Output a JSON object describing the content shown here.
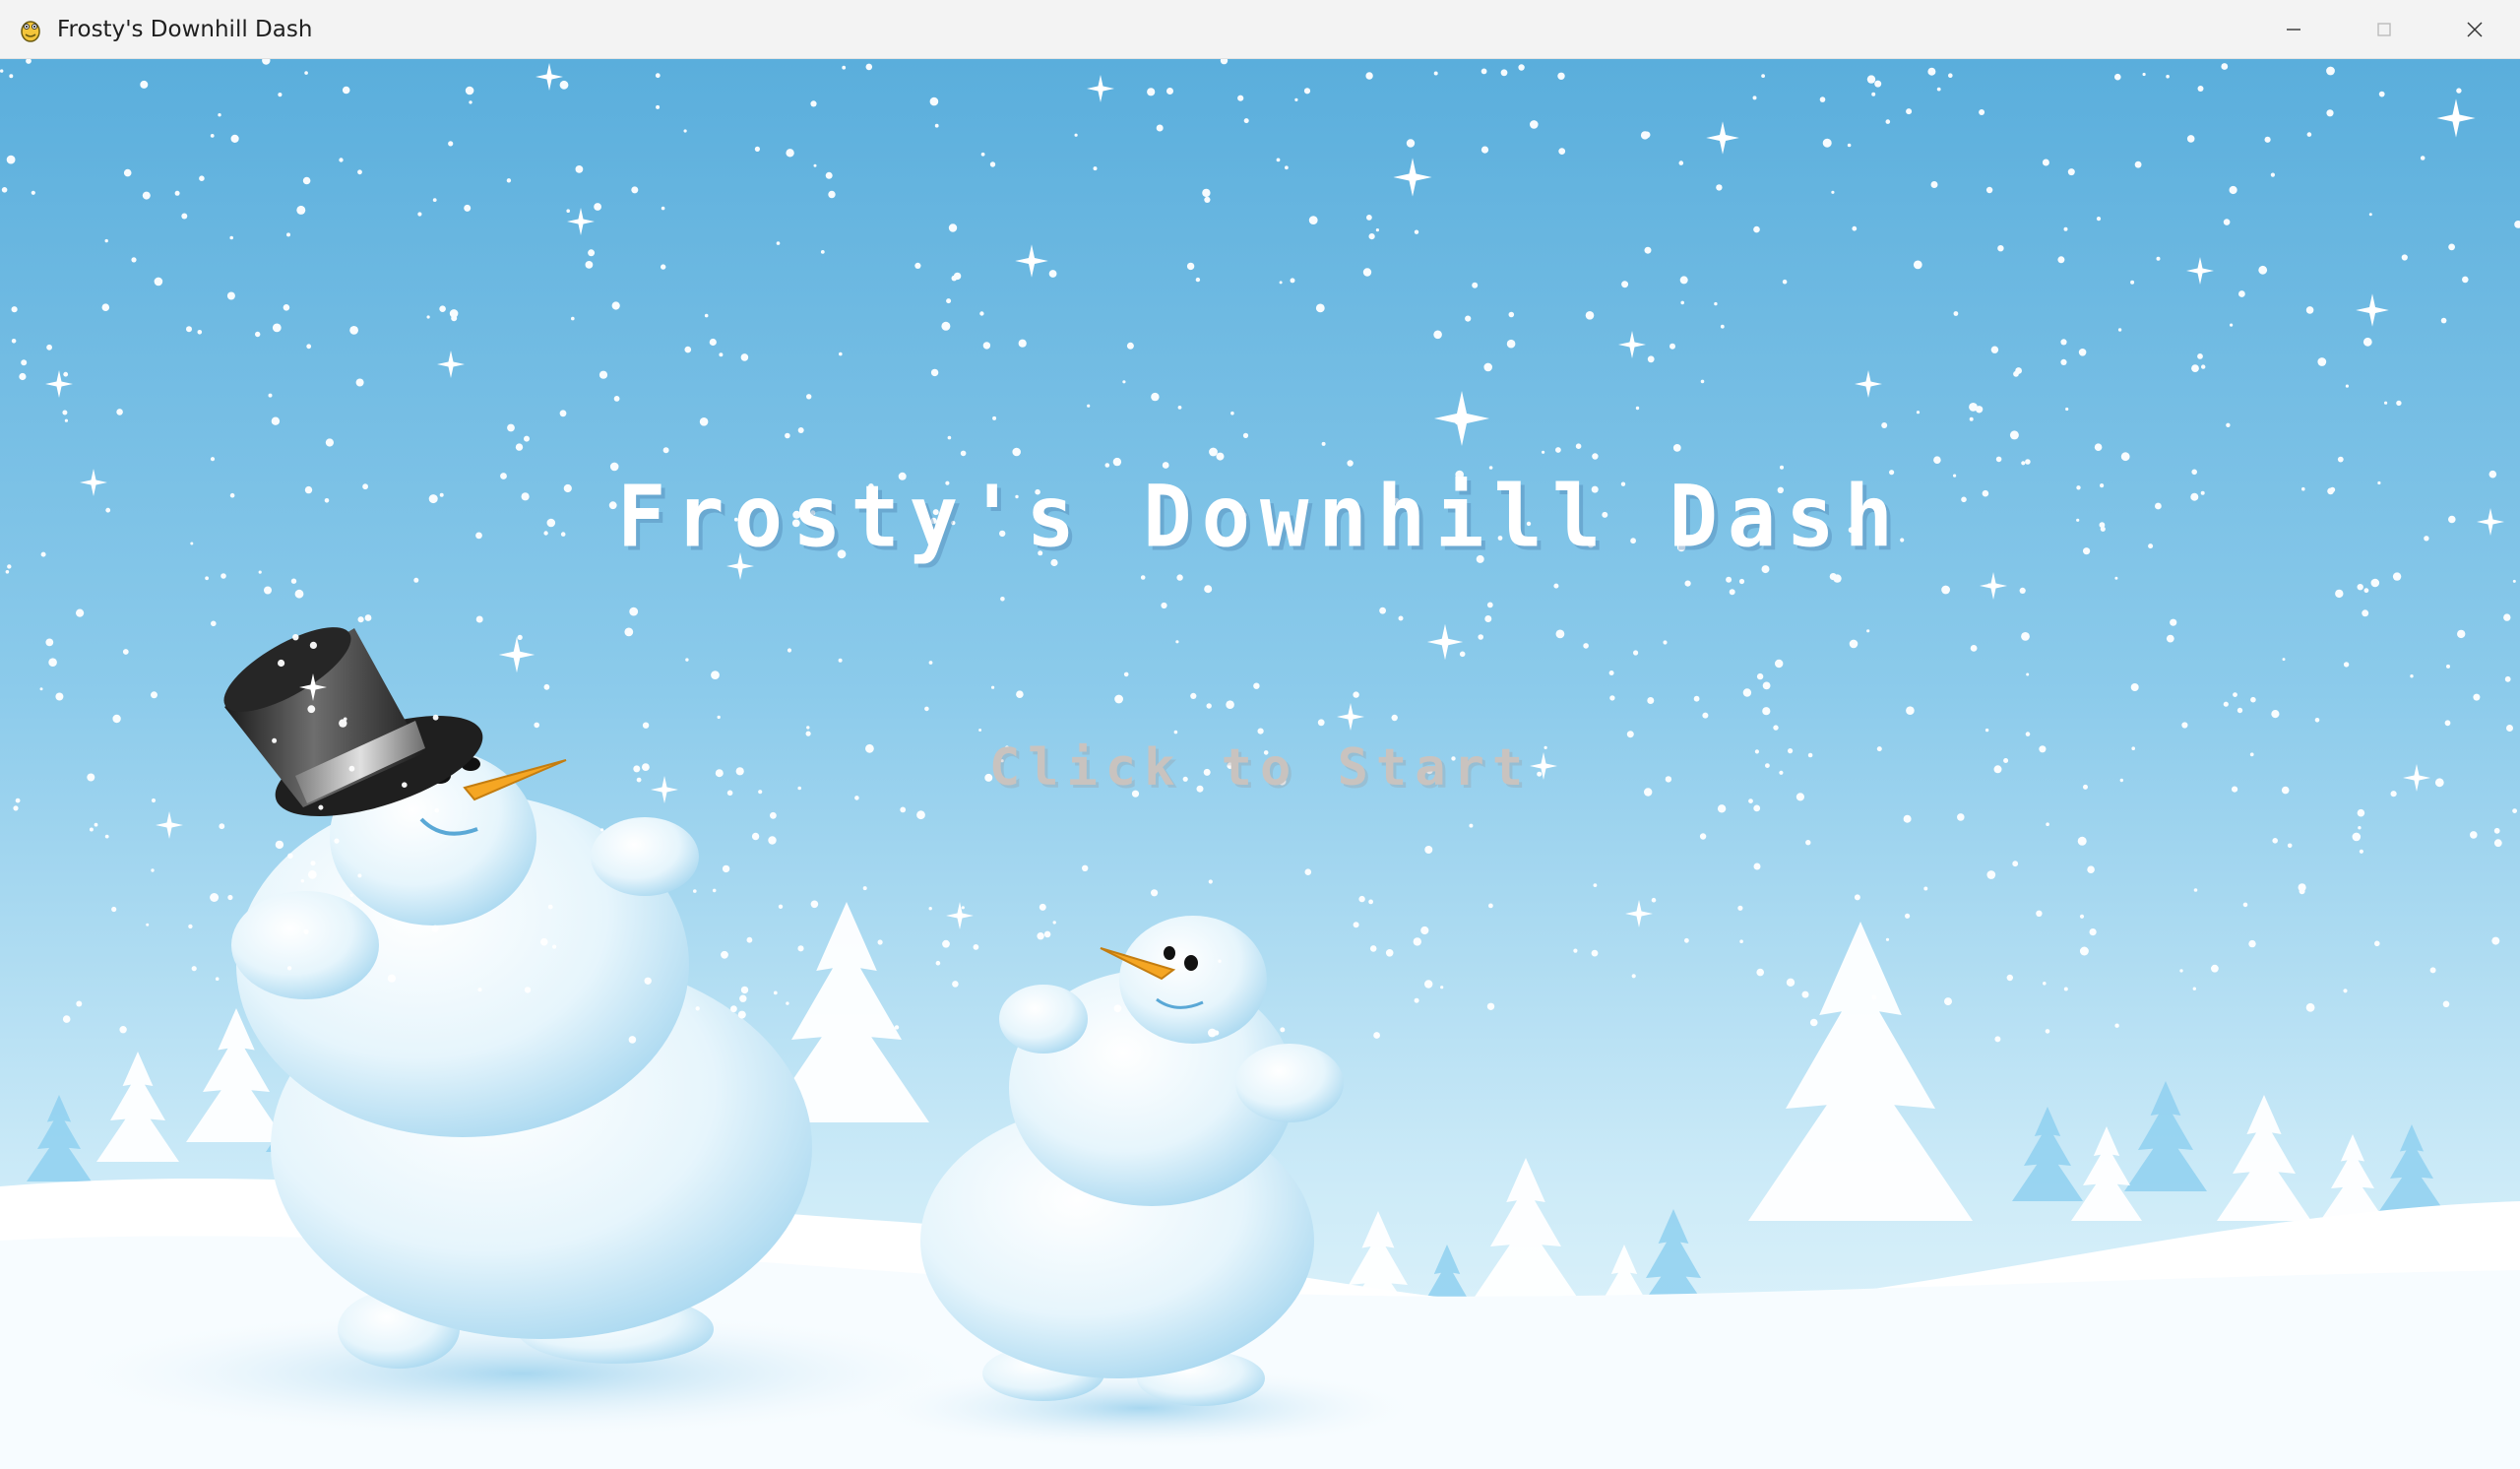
{
  "window": {
    "title": "Frosty's Downhill Dash",
    "app_icon": "pygame-snake-icon",
    "controls": [
      "minimize-icon",
      "maximize-icon",
      "close-icon"
    ]
  },
  "game": {
    "title": "Frosty's Downhill Dash",
    "start_prompt": "Click to Start",
    "colors": {
      "sky_top": "#5aaedc",
      "sky_bottom": "#d8f1fb",
      "snow": "#ffffff",
      "title_text": "#ffffff",
      "prompt_text": "#c9c3bf",
      "carrot": "#f5a623",
      "hat": "#2a2a2a"
    }
  }
}
